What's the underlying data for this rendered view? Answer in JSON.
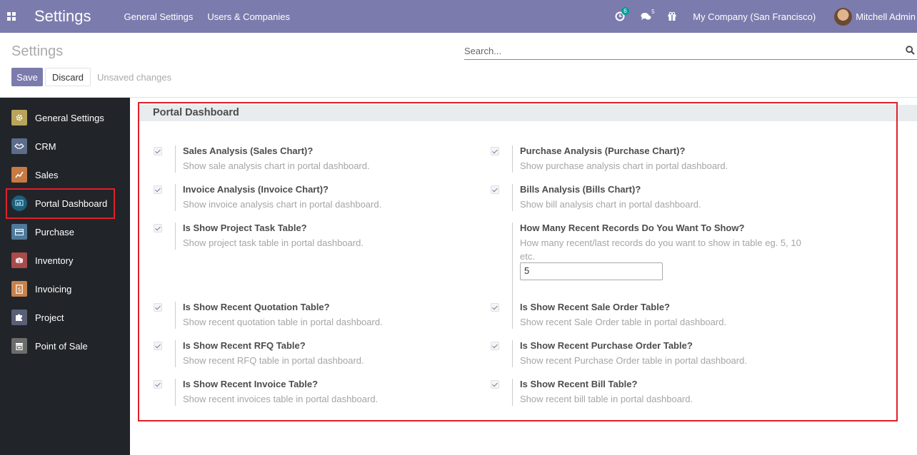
{
  "navbar": {
    "app_title": "Settings",
    "menus": [
      "General Settings",
      "Users & Companies"
    ],
    "activity_count": "6",
    "messages_count": "5",
    "company": "My Company (San Francisco)",
    "user": "Mitchell Admin"
  },
  "control_panel": {
    "title": "Settings",
    "search_placeholder": "Search...",
    "save_label": "Save",
    "discard_label": "Discard",
    "unsaved_label": "Unsaved changes"
  },
  "sidebar": {
    "items": [
      {
        "label": "General Settings",
        "icon": "gear-icon",
        "color": "#b8a45a"
      },
      {
        "label": "CRM",
        "icon": "handshake-icon",
        "color": "#5b6d8a"
      },
      {
        "label": "Sales",
        "icon": "chart-icon",
        "color": "#c77a43"
      },
      {
        "label": "Portal Dashboard",
        "icon": "dashboard-icon",
        "color": "#1f5f7a"
      },
      {
        "label": "Purchase",
        "icon": "card-icon",
        "color": "#4f7a9a"
      },
      {
        "label": "Inventory",
        "icon": "box-icon",
        "color": "#a84b4b"
      },
      {
        "label": "Invoicing",
        "icon": "invoice-icon",
        "color": "#c7824e"
      },
      {
        "label": "Project",
        "icon": "puzzle-icon",
        "color": "#5a5f78"
      },
      {
        "label": "Point of Sale",
        "icon": "store-icon",
        "color": "#6c6c6c"
      }
    ]
  },
  "section": {
    "title": "Portal Dashboard"
  },
  "settings": {
    "sales_analysis": {
      "label": "Sales Analysis (Sales Chart)?",
      "desc": "Show sale analysis chart in portal dashboard."
    },
    "purchase_analysis": {
      "label": "Purchase Analysis (Purchase Chart)?",
      "desc": "Show purchase analysis chart in portal dashboard."
    },
    "invoice_analysis": {
      "label": "Invoice Analysis (Invoice Chart)?",
      "desc": "Show invoice analysis chart in portal dashboard."
    },
    "bills_analysis": {
      "label": "Bills Analysis (Bills Chart)?",
      "desc": "Show bill analysis chart in portal dashboard."
    },
    "project_task": {
      "label": "Is Show Project Task Table?",
      "desc": "Show project task table in portal dashboard."
    },
    "recent_records": {
      "label": "How Many Recent Records Do You Want To Show?",
      "desc_line1": "How many recent/last records do you want to show in table eg. 5, 10",
      "desc_line2": "etc.",
      "value": "5"
    },
    "recent_quotation": {
      "label": "Is Show Recent Quotation Table?",
      "desc": "Show recent quotation table in portal dashboard."
    },
    "recent_sale_order": {
      "label": "Is Show Recent Sale Order Table?",
      "desc": "Show recent Sale Order table in portal dashboard."
    },
    "recent_rfq": {
      "label": "Is Show Recent RFQ Table?",
      "desc": "Show recent RFQ table in portal dashboard."
    },
    "recent_purchase_order": {
      "label": "Is Show Recent Purchase Order Table?",
      "desc": "Show recent Purchase Order table in portal dashboard."
    },
    "recent_invoice": {
      "label": "Is Show Recent Invoice Table?",
      "desc": "Show recent invoices table in portal dashboard."
    },
    "recent_bill": {
      "label": "Is Show Recent Bill Table?",
      "desc": "Show recent bill table in portal dashboard."
    }
  }
}
